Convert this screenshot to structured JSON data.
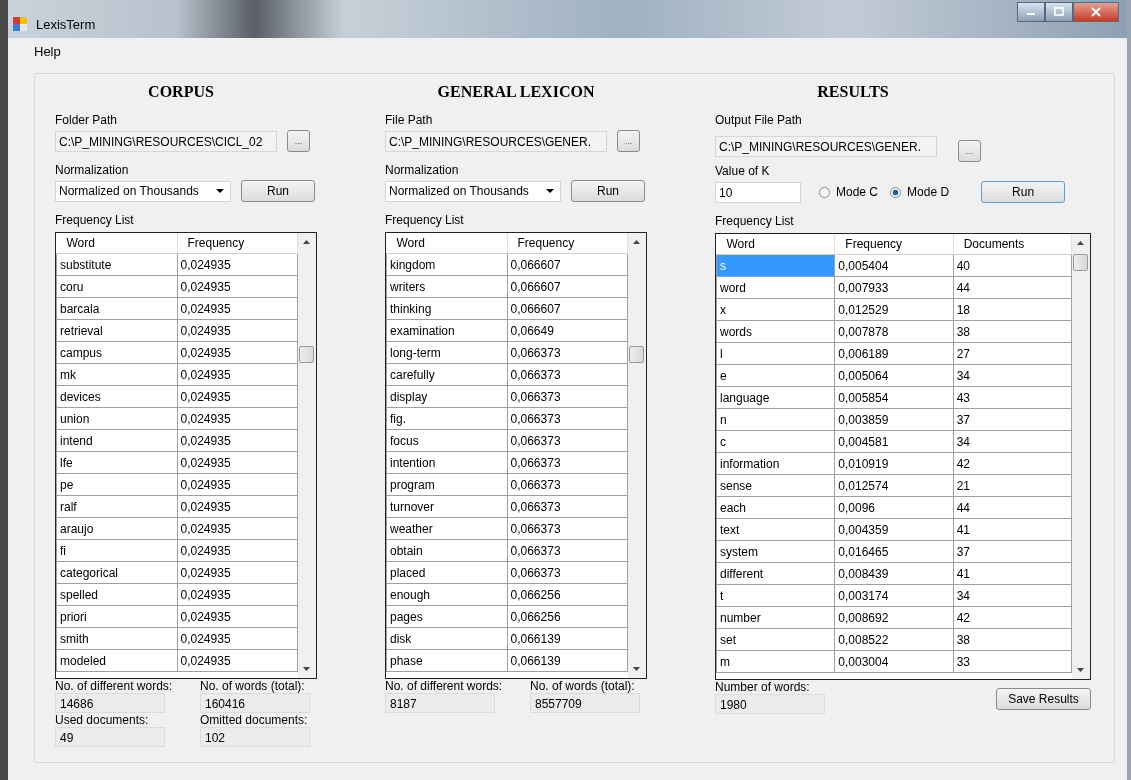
{
  "window": {
    "title": "LexisTerm"
  },
  "menu": [
    {
      "label": "Help"
    }
  ],
  "panels": [
    {
      "kind": "corpus",
      "heading": "CORPUS",
      "path": {
        "label": "Folder Path",
        "value": "C:\\P_MINING\\RESOURCES\\CICL_02",
        "button": "..."
      },
      "normalization": {
        "label": "Normalization",
        "value": "Normalized on Thousands",
        "button": "Run"
      },
      "list_label": "Frequency List",
      "table": {
        "columns": [
          "Word",
          "Frequency"
        ],
        "rows": [
          {
            "cells": [
              "substitute",
              "0,024935"
            ],
            "selected": false
          },
          {
            "cells": [
              "coru",
              "0,024935"
            ],
            "selected": false
          },
          {
            "cells": [
              "barcala",
              "0,024935"
            ],
            "selected": false
          },
          {
            "cells": [
              "retrieval",
              "0,024935"
            ],
            "selected": false
          },
          {
            "cells": [
              "campus",
              "0,024935"
            ],
            "selected": false
          },
          {
            "cells": [
              "mk",
              "0,024935"
            ],
            "selected": false
          },
          {
            "cells": [
              "devices",
              "0,024935"
            ],
            "selected": false
          },
          {
            "cells": [
              "union",
              "0,024935"
            ],
            "selected": false
          },
          {
            "cells": [
              "intend",
              "0,024935"
            ],
            "selected": false
          },
          {
            "cells": [
              "lfe",
              "0,024935"
            ],
            "selected": false
          },
          {
            "cells": [
              "pe",
              "0,024935"
            ],
            "selected": false
          },
          {
            "cells": [
              "ralf",
              "0,024935"
            ],
            "selected": false
          },
          {
            "cells": [
              "araujo",
              "0,024935"
            ],
            "selected": false
          },
          {
            "cells": [
              "fi",
              "0,024935"
            ],
            "selected": false
          },
          {
            "cells": [
              "categorical",
              "0,024935"
            ],
            "selected": false
          },
          {
            "cells": [
              "spelled",
              "0,024935"
            ],
            "selected": false
          },
          {
            "cells": [
              "priori",
              "0,024935"
            ],
            "selected": false
          },
          {
            "cells": [
              "smith",
              "0,024935"
            ],
            "selected": false
          },
          {
            "cells": [
              "modeled",
              "0,024935"
            ],
            "selected": false
          }
        ]
      },
      "stats": [
        {
          "label": "No. of different words:",
          "value": "14686"
        },
        {
          "label": "No. of words (total):",
          "value": "160416"
        },
        {
          "label": "Used documents:",
          "value": "49"
        },
        {
          "label": "Omitted documents:",
          "value": "102"
        }
      ]
    },
    {
      "kind": "lexicon",
      "heading": "GENERAL LEXICON",
      "path": {
        "label": "File Path",
        "value": "C:\\P_MINING\\RESOURCES\\GENER.",
        "button": "..."
      },
      "normalization": {
        "label": "Normalization",
        "value": "Normalized on Thousands",
        "button": "Run"
      },
      "list_label": "Frequency List",
      "table": {
        "columns": [
          "Word",
          "Frequency"
        ],
        "rows": [
          {
            "cells": [
              "kingdom",
              "0,066607"
            ],
            "selected": false
          },
          {
            "cells": [
              "writers",
              "0,066607"
            ],
            "selected": false
          },
          {
            "cells": [
              "thinking",
              "0,066607"
            ],
            "selected": false
          },
          {
            "cells": [
              "examination",
              "0,06649"
            ],
            "selected": false
          },
          {
            "cells": [
              "long-term",
              "0,066373"
            ],
            "selected": false
          },
          {
            "cells": [
              "carefully",
              "0,066373"
            ],
            "selected": false
          },
          {
            "cells": [
              "display",
              "0,066373"
            ],
            "selected": false
          },
          {
            "cells": [
              "fig.",
              "0,066373"
            ],
            "selected": false
          },
          {
            "cells": [
              "focus",
              "0,066373"
            ],
            "selected": false
          },
          {
            "cells": [
              "intention",
              "0,066373"
            ],
            "selected": false
          },
          {
            "cells": [
              "program",
              "0,066373"
            ],
            "selected": false
          },
          {
            "cells": [
              "turnover",
              "0,066373"
            ],
            "selected": false
          },
          {
            "cells": [
              "weather",
              "0,066373"
            ],
            "selected": false
          },
          {
            "cells": [
              "obtain",
              "0,066373"
            ],
            "selected": false
          },
          {
            "cells": [
              "placed",
              "0,066373"
            ],
            "selected": false
          },
          {
            "cells": [
              "enough",
              "0,066256"
            ],
            "selected": false
          },
          {
            "cells": [
              "pages",
              "0,066256"
            ],
            "selected": false
          },
          {
            "cells": [
              "disk",
              "0,066139"
            ],
            "selected": false
          },
          {
            "cells": [
              "phase",
              "0,066139"
            ],
            "selected": false
          }
        ]
      },
      "stats": [
        {
          "label": "No. of different words:",
          "value": "8187"
        },
        {
          "label": "No. of words (total):",
          "value": "8557709"
        }
      ]
    },
    {
      "kind": "results",
      "heading": "RESULTS",
      "path": {
        "label": "Output File Path",
        "value": "C:\\P_MINING\\RESOURCES\\GENER.",
        "button": "..."
      },
      "k": {
        "label": "Value of K",
        "value": "10",
        "modes": [
          {
            "label": "Mode C",
            "selected": false
          },
          {
            "label": "Mode D",
            "selected": true
          }
        ],
        "button": "Run"
      },
      "list_label": "Frequency List",
      "table": {
        "columns": [
          "Word",
          "Frequency",
          "Documents"
        ],
        "rows": [
          {
            "cells": [
              "s",
              "0,005404",
              "40"
            ],
            "selected": true
          },
          {
            "cells": [
              "word",
              "0,007933",
              "44"
            ],
            "selected": false
          },
          {
            "cells": [
              "x",
              "0,012529",
              "18"
            ],
            "selected": false
          },
          {
            "cells": [
              "words",
              "0,007878",
              "38"
            ],
            "selected": false
          },
          {
            "cells": [
              "l",
              "0,006189",
              "27"
            ],
            "selected": false
          },
          {
            "cells": [
              "e",
              "0,005064",
              "34"
            ],
            "selected": false
          },
          {
            "cells": [
              "language",
              "0,005854",
              "43"
            ],
            "selected": false
          },
          {
            "cells": [
              "n",
              "0,003859",
              "37"
            ],
            "selected": false
          },
          {
            "cells": [
              "c",
              "0,004581",
              "34"
            ],
            "selected": false
          },
          {
            "cells": [
              "information",
              "0,010919",
              "42"
            ],
            "selected": false
          },
          {
            "cells": [
              "sense",
              "0,012574",
              "21"
            ],
            "selected": false
          },
          {
            "cells": [
              "each",
              "0,0096",
              "44"
            ],
            "selected": false
          },
          {
            "cells": [
              "text",
              "0,004359",
              "41"
            ],
            "selected": false
          },
          {
            "cells": [
              "system",
              "0,016465",
              "37"
            ],
            "selected": false
          },
          {
            "cells": [
              "different",
              "0,008439",
              "41"
            ],
            "selected": false
          },
          {
            "cells": [
              "t",
              "0,003174",
              "34"
            ],
            "selected": false
          },
          {
            "cells": [
              "number",
              "0,008692",
              "42"
            ],
            "selected": false
          },
          {
            "cells": [
              "set",
              "0,008522",
              "38"
            ],
            "selected": false
          },
          {
            "cells": [
              "m",
              "0,003004",
              "33"
            ],
            "selected": false
          }
        ]
      },
      "stats": [
        {
          "label": "Number of words:",
          "value": "1980"
        }
      ],
      "save_button": "Save Results"
    }
  ]
}
